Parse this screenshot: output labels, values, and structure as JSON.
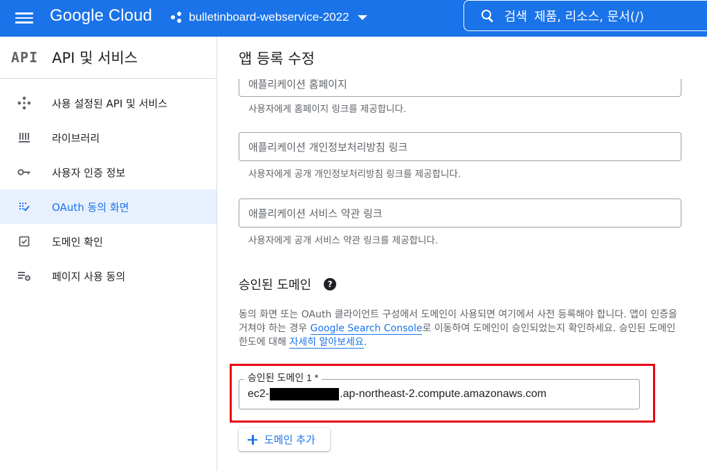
{
  "topbar": {
    "brand": "Google Cloud",
    "project_name": "bulletinboard-webservice-2022",
    "search_label": "검색",
    "search_hint": "제품, 리소스, 문서(/)"
  },
  "sidebar": {
    "logo": "API",
    "title": "API 및 서비스",
    "items": [
      {
        "label": "사용 설정된 API 및 서비스",
        "icon": "enabled-apis-icon",
        "active": false
      },
      {
        "label": "라이브러리",
        "icon": "library-icon",
        "active": false
      },
      {
        "label": "사용자 인증 정보",
        "icon": "key-icon",
        "active": false
      },
      {
        "label": "OAuth 동의 화면",
        "icon": "oauth-consent-icon",
        "active": true
      },
      {
        "label": "도메인 확인",
        "icon": "checkbox-icon",
        "active": false
      },
      {
        "label": "페이지 사용 동의",
        "icon": "page-settings-icon",
        "active": false
      }
    ]
  },
  "main": {
    "title": "앱 등록 수정",
    "fields": [
      {
        "placeholder": "애플리케이션 홈페이지",
        "helper": "사용자에게 홈페이지 링크를 제공합니다."
      },
      {
        "placeholder": "애플리케이션 개인정보처리방침 링크",
        "helper": "사용자에게 공개 개인정보처리방침 링크를 제공합니다."
      },
      {
        "placeholder": "애플리케이션 서비스 약관 링크",
        "helper": "사용자에게 공개 서비스 약관 링크를 제공합니다."
      }
    ],
    "authorized_domains": {
      "title": "승인된 도메인",
      "desc_1": "동의 화면 또는 OAuth 클라이언트 구성에서 도메인이 사용되면 여기에서 사전 등록해야 합니다. 앱이 인증을 거쳐야 하는 경우 ",
      "link_1": "Google Search Console",
      "desc_2": "로 이동하여 도메인이 승인되었는지 확인하세요. 승인된 도메인 한도에 대해 ",
      "link_2": "자세히 알아보세요",
      "desc_3": ".",
      "domain_label": "승인된 도메인 1 *",
      "domain_prefix": "ec2-",
      "domain_suffix": ".ap-northeast-2.compute.amazonaws.com",
      "add_button": "도메인 추가"
    }
  },
  "colors": {
    "accent": "#1a73e8",
    "highlight": "#e60012",
    "active_bg": "#e8f0fe"
  }
}
